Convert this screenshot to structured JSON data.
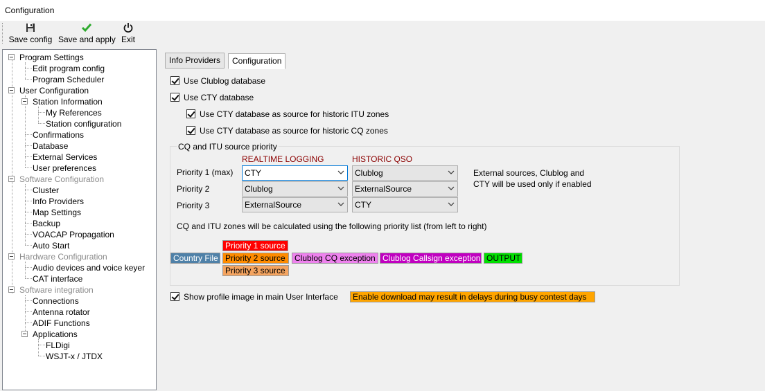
{
  "window": {
    "title": "Configuration"
  },
  "toolbar": {
    "save_config": "Save config",
    "save_apply": "Save and apply",
    "exit": "Exit"
  },
  "tree": {
    "program_settings": "Program Settings",
    "edit_program_config": "Edit program config",
    "program_scheduler": "Program Scheduler",
    "user_configuration": "User Configuration",
    "station_information": "Station Information",
    "my_references": "My References",
    "station_configuration": "Station configuration",
    "confirmations": "Confirmations",
    "database": "Database",
    "external_services": "External Services",
    "user_preferences": "User preferences",
    "software_configuration": "Software Configuration",
    "cluster": "Cluster",
    "info_providers": "Info Providers",
    "map_settings": "Map Settings",
    "backup": "Backup",
    "voacap": "VOACAP Propagation",
    "auto_start": "Auto Start",
    "hardware_configuration": "Hardware Configuration",
    "audio_devices": "Audio devices and voice keyer",
    "cat_interface": "CAT interface",
    "software_integration": "Software integration",
    "connections": "Connections",
    "antenna_rotator": "Antenna rotator",
    "adif_functions": "ADIF Functions",
    "applications": "Applications",
    "fldigi": "FLDigi",
    "wsjtx": "WSJT-x / JTDX"
  },
  "tabs": {
    "info_providers": "Info Providers",
    "configuration": "Configuration"
  },
  "options": {
    "use_clublog": "Use Clublog database",
    "use_cty": "Use CTY database",
    "cty_itu": "Use CTY database as source for historic ITU zones",
    "cty_cq": "Use CTY database as source for historic CQ zones",
    "show_profile": "Show profile image in main User Interface"
  },
  "priority": {
    "group_title": "CQ and ITU source priority",
    "realtime_header": "REALTIME LOGGING",
    "historic_header": "HISTORIC QSO",
    "rows": [
      {
        "label": "Priority 1 (max)",
        "realtime": "CTY",
        "historic": "Clublog"
      },
      {
        "label": "Priority 2",
        "realtime": "Clublog",
        "historic": "ExternalSource"
      },
      {
        "label": "Priority 3",
        "realtime": "ExternalSource",
        "historic": "CTY"
      }
    ],
    "note": "External sources, Clublog and\nCTY will be used only if enabled",
    "list_caption": "CQ and ITU zones will be calculated using the following priority list (from left to right)"
  },
  "pipeline": {
    "country_file": "Country File",
    "p1": "Priority 1 source",
    "p2": "Priority 2 source",
    "p3": "Priority 3 source",
    "clublog_cq": "Clublog CQ exception",
    "clublog_callsign": "Clublog Callsign exception",
    "output": "OUTPUT"
  },
  "warning": "Enable download may result in delays during busy contest days",
  "colors": {
    "country_file": "#4f81a8",
    "p1": "#ff0000",
    "p2": "#ff8c00",
    "p3": "#f4a460",
    "clublog_cq": "#ee82ee",
    "clublog_callsign": "#c000c0",
    "output": "#00e000",
    "warning": "#ffa500"
  }
}
